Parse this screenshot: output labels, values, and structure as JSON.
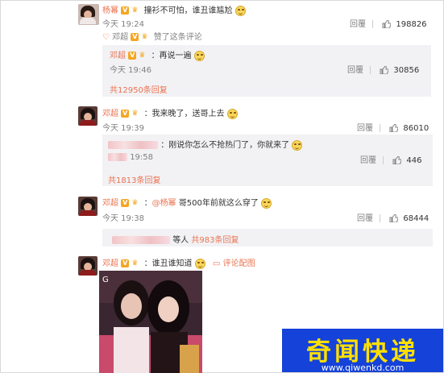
{
  "colors": {
    "accent": "#eb7350",
    "watermark_bg": "#1542d8",
    "watermark_text": "#ffe000"
  },
  "badges": {
    "verified": "V",
    "crown": "♛"
  },
  "icons": {
    "like": "thumb-up-icon",
    "emoji": "smirk-emoji-icon",
    "comment": "comment-icon"
  },
  "comment1": {
    "user": "杨幂",
    "text": "撞衫不可怕，谁丑谁尴尬",
    "time": "今天 19:24",
    "reply_label": "回覆",
    "likes": "198826",
    "liked_by_user": "邓超",
    "liked_by_text": "赞了这条评论",
    "sub": {
      "user": "邓超",
      "text": "：再说一遍",
      "time": "今天 19:46",
      "reply_label": "回覆",
      "likes": "30856"
    },
    "total": "共12950条回复"
  },
  "comment2": {
    "user": "邓超",
    "text": "：我来晚了，送哥上去",
    "time": "今天 19:39",
    "reply_label": "回覆",
    "likes": "86010",
    "sub": {
      "text": "：刚说你怎么不抢热门了，你就来了",
      "time": "19:58",
      "reply_label": "回覆",
      "likes": "446"
    },
    "total": "共1813条回复"
  },
  "comment3": {
    "user": "邓超",
    "mention": "@杨幂",
    "text": "哥500年前就这么穿了",
    "time": "今天 19:38",
    "reply_label": "回覆",
    "likes": "68444",
    "more_prefix": "等人",
    "total": "共983条回复"
  },
  "comment4": {
    "user": "邓超",
    "text": "：谁丑谁知道",
    "pic_comment": "评论配图"
  },
  "watermark": {
    "title": "奇闻快递",
    "url": "www.qiwenkd.com"
  }
}
